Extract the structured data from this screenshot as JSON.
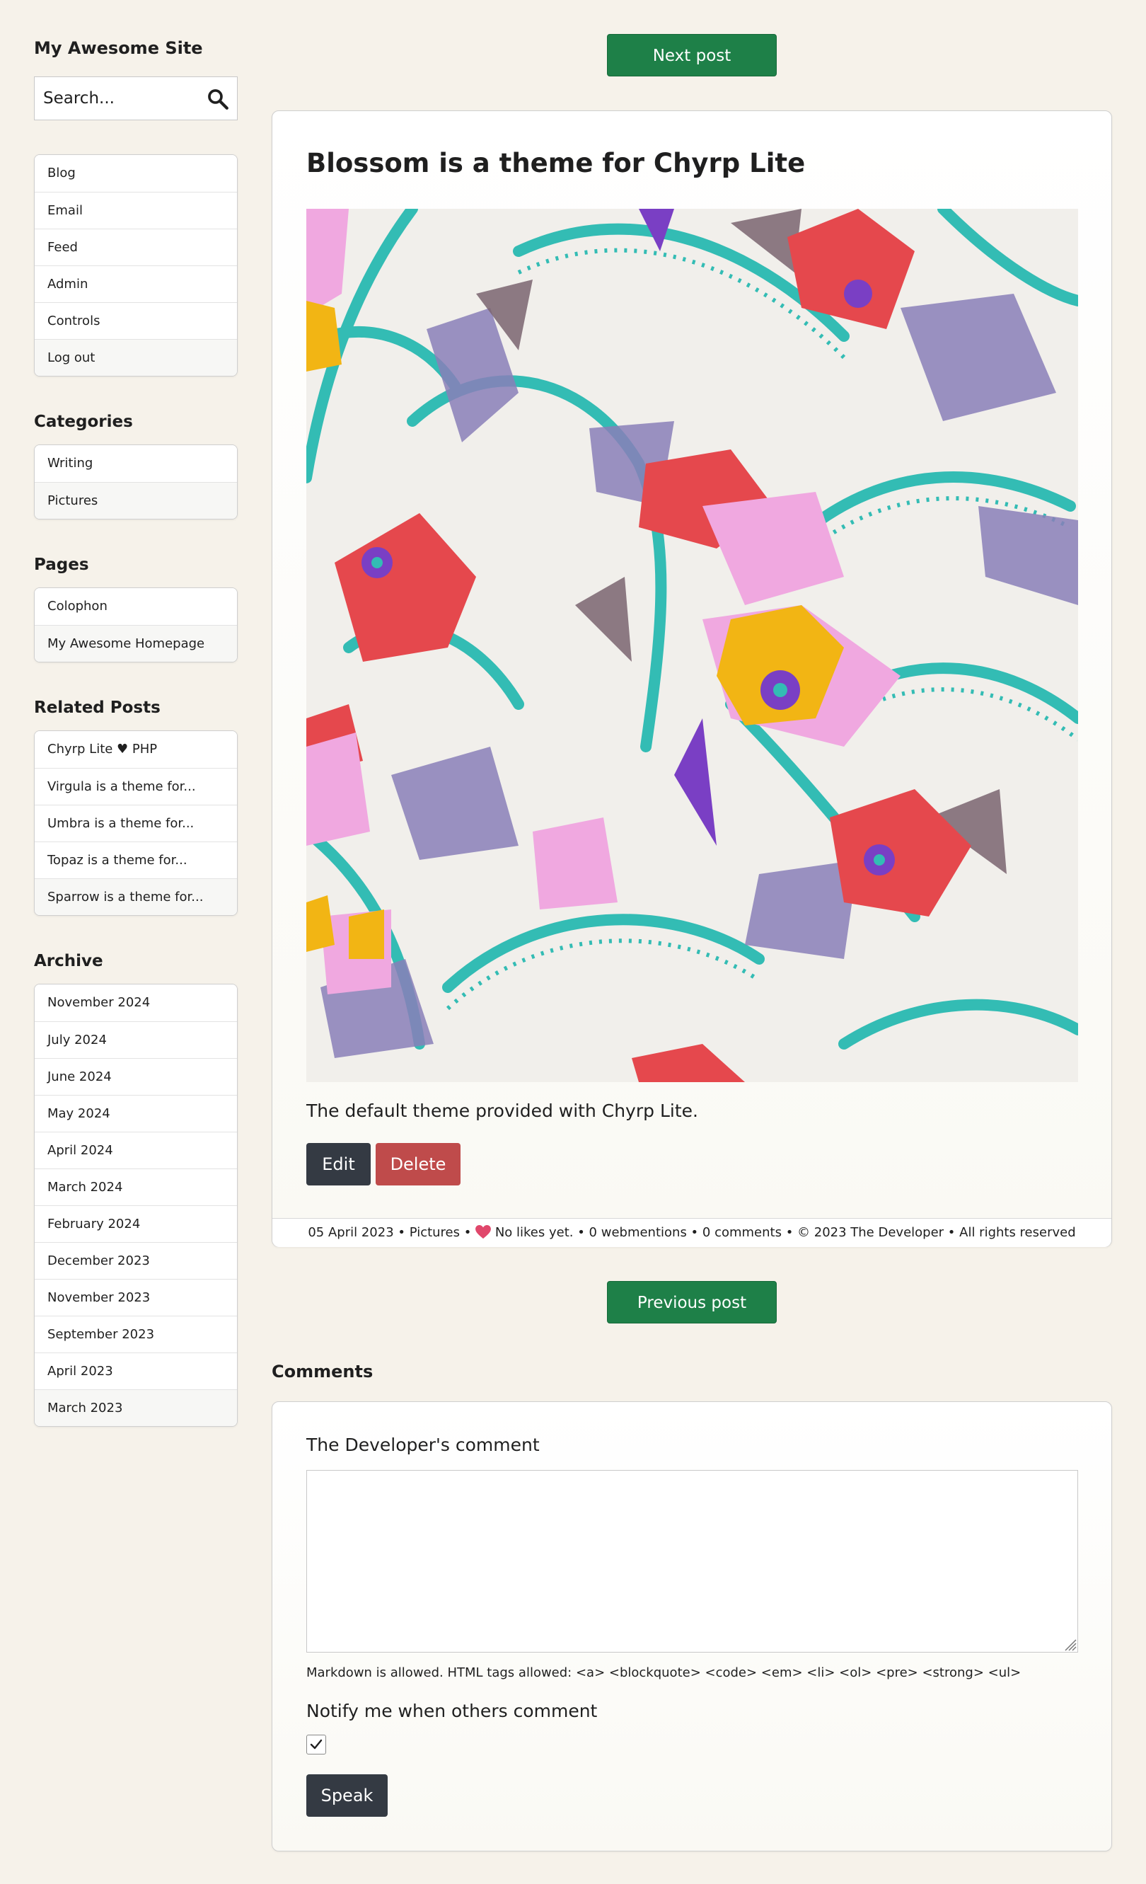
{
  "site": {
    "title": "My Awesome Site"
  },
  "search": {
    "placeholder": "Search..."
  },
  "nav_menu": [
    "Blog",
    "Email",
    "Feed",
    "Admin",
    "Controls",
    "Log out"
  ],
  "categories": {
    "heading": "Categories",
    "items": [
      "Writing",
      "Pictures"
    ]
  },
  "pages": {
    "heading": "Pages",
    "items": [
      "Colophon",
      "My Awesome Homepage"
    ]
  },
  "related": {
    "heading": "Related Posts",
    "items": [
      "Chyrp Lite ♥ PHP",
      "Virgula is a theme for...",
      "Umbra is a theme for...",
      "Topaz is a theme for...",
      "Sparrow is a theme for..."
    ]
  },
  "archive": {
    "heading": "Archive",
    "items": [
      "November 2024",
      "July 2024",
      "June 2024",
      "May 2024",
      "April 2024",
      "March 2024",
      "February 2024",
      "December 2023",
      "November 2023",
      "September 2023",
      "April 2023",
      "March 2023"
    ]
  },
  "navigation": {
    "next": "Next post",
    "previous": "Previous post"
  },
  "post": {
    "title": "Blossom is a theme for Chyrp Lite",
    "body": "The default theme provided with Chyrp Lite.",
    "edit_label": "Edit",
    "delete_label": "Delete",
    "footer": {
      "date": "05 April 2023",
      "category": "Pictures",
      "likes": "No likes yet.",
      "webmentions": "0 webmentions",
      "comments": "0 comments",
      "copyright": "© 2023 The Developer",
      "rights": "All rights reserved"
    }
  },
  "comments": {
    "heading": "Comments",
    "form_label": "The Developer's comment",
    "markdown_note": "Markdown is allowed. HTML tags allowed: <a> <blockquote> <code> <em> <li> <ol> <pre> <strong> <ul>",
    "notify_label": "Notify me when others comment",
    "notify_checked": true,
    "submit_label": "Speak"
  },
  "colors": {
    "background": "#f6f2ea",
    "green_button": "#1e8048",
    "dark_button": "#343a43",
    "delete_button": "#bf4b4b",
    "heart": "#e0476b"
  }
}
